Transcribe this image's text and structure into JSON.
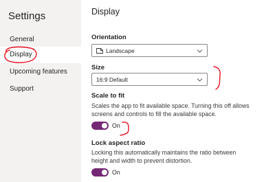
{
  "sidebar": {
    "title": "Settings",
    "items": [
      {
        "label": "General",
        "selected": false
      },
      {
        "label": "Display",
        "selected": true
      },
      {
        "label": "Upcoming features",
        "selected": false
      },
      {
        "label": "Support",
        "selected": false
      }
    ]
  },
  "main": {
    "title": "Display",
    "orientation": {
      "label": "Orientation",
      "value": "Landscape",
      "icon": "page-landscape-icon"
    },
    "size": {
      "label": "Size",
      "value": "16:9 Default"
    },
    "scale_to_fit": {
      "label": "Scale to fit",
      "description": "Scales the app to fit available space. Turning this off allows screens and controls to fill the available space.",
      "state": "On"
    },
    "lock_aspect_ratio": {
      "label": "Lock aspect ratio",
      "description": "Locking this automatically maintains the ratio between height and width to prevent distortion.",
      "state": "On"
    }
  },
  "colors": {
    "accent": "#742774",
    "sidebar_bg": "#f3f2f1",
    "annotation": "#e81123"
  }
}
